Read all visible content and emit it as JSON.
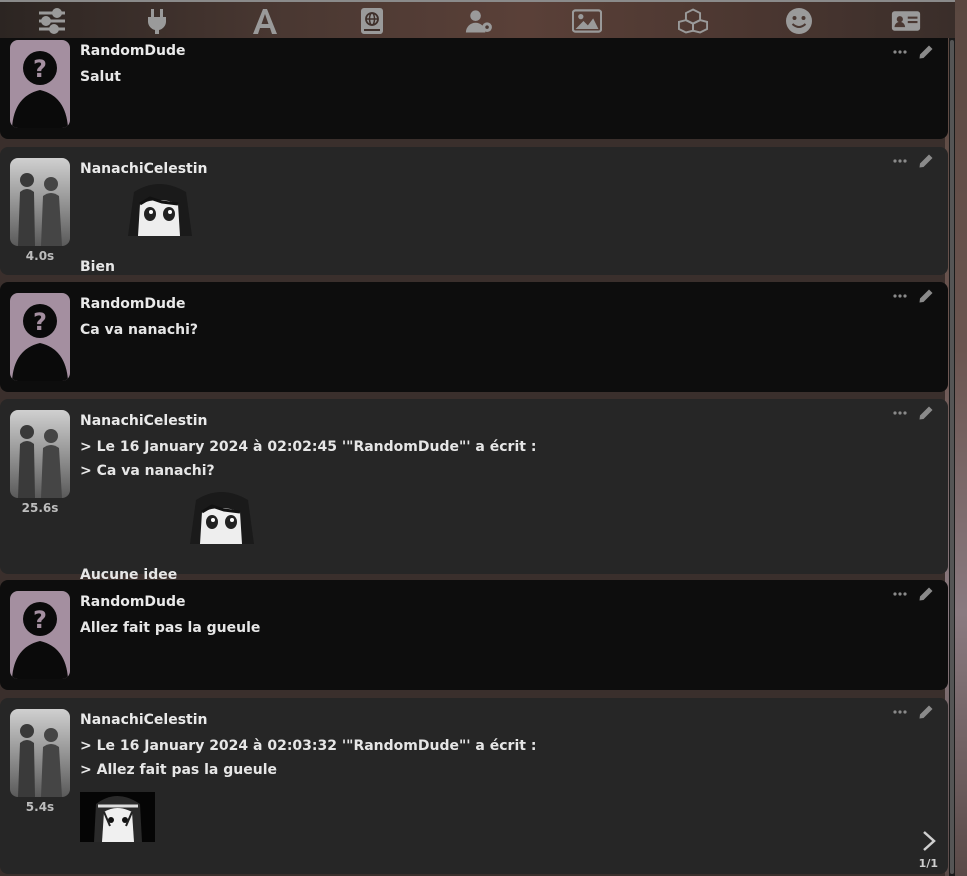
{
  "toolbar": {
    "icons": [
      "sliders-icon",
      "plug-icon",
      "font-icon",
      "globe-book-icon",
      "user-gear-icon",
      "image-icon",
      "cubes-icon",
      "smiley-icon",
      "id-card-icon"
    ]
  },
  "messages": [
    {
      "name": "RandomDude",
      "lines": [
        "Salut"
      ],
      "timer": ""
    },
    {
      "name": "NanachiCelestin",
      "lines": [
        "Bien"
      ],
      "timer": "4.0s"
    },
    {
      "name": "RandomDude",
      "lines": [
        "Ca va nanachi?"
      ],
      "timer": ""
    },
    {
      "name": "NanachiCelestin",
      "lines": [
        "> Le 16 January 2024 à 02:02:45 '\"RandomDude\"' a écrit :",
        "> Ca va nanachi?",
        "Aucune idee"
      ],
      "timer": "25.6s"
    },
    {
      "name": "RandomDude",
      "lines": [
        "Allez fait pas la gueule"
      ],
      "timer": ""
    },
    {
      "name": "NanachiCelestin",
      "lines": [
        "> Le 16 January 2024 à 02:03:32 '\"RandomDude\"' a écrit :",
        "> Allez fait pas la gueule"
      ],
      "timer": "5.4s"
    }
  ],
  "swipe": {
    "counter": "1/1"
  },
  "colors": {
    "user_bg": "#0d0d0d",
    "char_bg": "#262626",
    "avatar_user_bg": "#a48fa0"
  }
}
